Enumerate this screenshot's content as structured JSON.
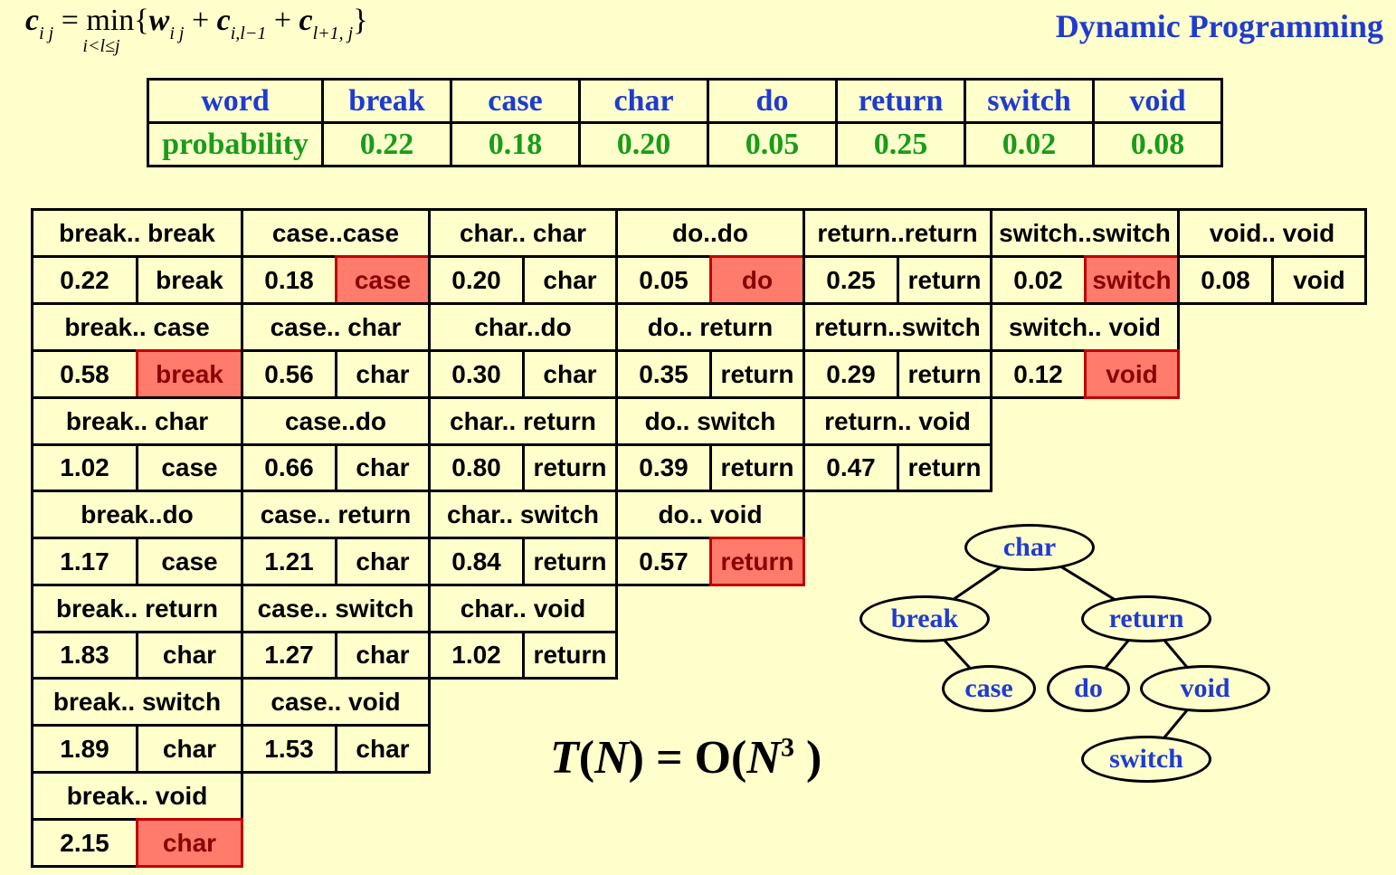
{
  "title": "Dynamic Programming",
  "formula": {
    "lhs": "c",
    "lhs_sub": "i j",
    "min": "min",
    "min_sub": "i<l≤j",
    "w": "w",
    "w_sub": "i j",
    "c1": "c",
    "c1_sub": "i,l−1",
    "c2": "c",
    "c2_sub": "l+1, j"
  },
  "probability_table": {
    "row_labels": [
      "word",
      "probability"
    ],
    "words": [
      "break",
      "case",
      "char",
      "do",
      "return",
      "switch",
      "void"
    ],
    "probabilities": [
      "0.22",
      "0.18",
      "0.20",
      "0.05",
      "0.25",
      "0.02",
      "0.08"
    ]
  },
  "dp_table": [
    [
      {
        "range": "break.. break",
        "cost": "0.22",
        "root": "break",
        "highlight": false
      },
      {
        "range": "break.. case",
        "cost": "0.58",
        "root": "break",
        "highlight": true
      },
      {
        "range": "break.. char",
        "cost": "1.02",
        "root": "case",
        "highlight": false
      },
      {
        "range": "break..do",
        "cost": "1.17",
        "root": "case",
        "highlight": false
      },
      {
        "range": "break.. return",
        "cost": "1.83",
        "root": "char",
        "highlight": false
      },
      {
        "range": "break.. switch",
        "cost": "1.89",
        "root": "char",
        "highlight": false
      },
      {
        "range": "break.. void",
        "cost": "2.15",
        "root": "char",
        "highlight": true
      }
    ],
    [
      {
        "range": "case..case",
        "cost": "0.18",
        "root": "case",
        "highlight": true
      },
      {
        "range": "case.. char",
        "cost": "0.56",
        "root": "char",
        "highlight": false
      },
      {
        "range": "case..do",
        "cost": "0.66",
        "root": "char",
        "highlight": false
      },
      {
        "range": "case.. return",
        "cost": "1.21",
        "root": "char",
        "highlight": false
      },
      {
        "range": "case.. switch",
        "cost": "1.27",
        "root": "char",
        "highlight": false
      },
      {
        "range": "case.. void",
        "cost": "1.53",
        "root": "char",
        "highlight": false
      }
    ],
    [
      {
        "range": "char.. char",
        "cost": "0.20",
        "root": "char",
        "highlight": false
      },
      {
        "range": "char..do",
        "cost": "0.30",
        "root": "char",
        "highlight": false
      },
      {
        "range": "char.. return",
        "cost": "0.80",
        "root": "return",
        "highlight": false
      },
      {
        "range": "char.. switch",
        "cost": "0.84",
        "root": "return",
        "highlight": false
      },
      {
        "range": "char.. void",
        "cost": "1.02",
        "root": "return",
        "highlight": false
      }
    ],
    [
      {
        "range": "do..do",
        "cost": "0.05",
        "root": "do",
        "highlight": true
      },
      {
        "range": "do.. return",
        "cost": "0.35",
        "root": "return",
        "highlight": false
      },
      {
        "range": "do.. switch",
        "cost": "0.39",
        "root": "return",
        "highlight": false
      },
      {
        "range": "do.. void",
        "cost": "0.57",
        "root": "return",
        "highlight": true
      }
    ],
    [
      {
        "range": "return..return",
        "cost": "0.25",
        "root": "return",
        "highlight": false
      },
      {
        "range": "return..switch",
        "cost": "0.29",
        "root": "return",
        "highlight": false
      },
      {
        "range": "return.. void",
        "cost": "0.47",
        "root": "return",
        "highlight": false
      }
    ],
    [
      {
        "range": "switch..switch",
        "cost": "0.02",
        "root": "switch",
        "highlight": true
      },
      {
        "range": "switch.. void",
        "cost": "0.12",
        "root": "void",
        "highlight": true
      }
    ],
    [
      {
        "range": "void.. void",
        "cost": "0.08",
        "root": "void",
        "highlight": false
      }
    ]
  ],
  "tree": {
    "nodes": [
      {
        "id": "char",
        "label": "char"
      },
      {
        "id": "break",
        "label": "break"
      },
      {
        "id": "return",
        "label": "return"
      },
      {
        "id": "case",
        "label": "case"
      },
      {
        "id": "do",
        "label": "do"
      },
      {
        "id": "void",
        "label": "void"
      },
      {
        "id": "switch",
        "label": "switch"
      }
    ],
    "edges": [
      [
        "char",
        "break"
      ],
      [
        "char",
        "return"
      ],
      [
        "break",
        "case"
      ],
      [
        "return",
        "do"
      ],
      [
        "return",
        "void"
      ],
      [
        "void",
        "switch"
      ]
    ]
  },
  "complexity": {
    "T": "T",
    "open1": "(",
    "N": "N",
    "close1": ") = O(",
    "N2": "N",
    "exp": "3",
    "close2": " )"
  },
  "colors": {
    "background": "#ffffcc",
    "title_blue": "#1f3bd1",
    "prob_green": "#1a9c1a",
    "highlight_fill": "#ff7b6b",
    "highlight_text": "#8b0000"
  }
}
